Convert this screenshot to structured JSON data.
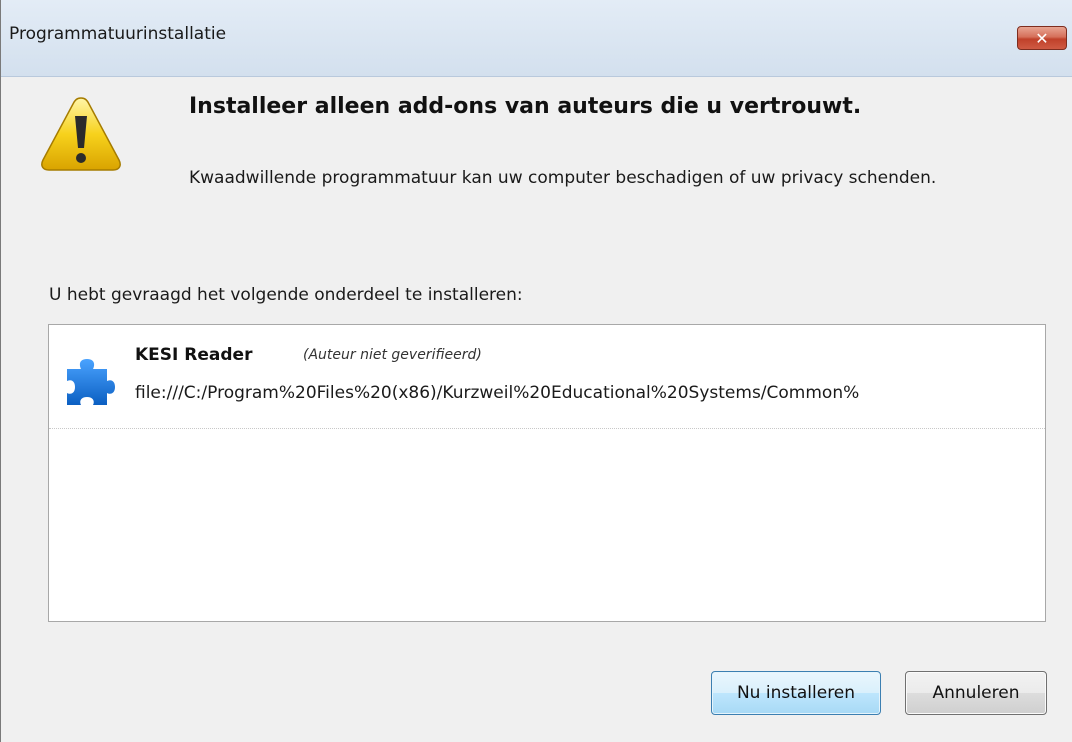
{
  "window": {
    "title": "Programmatuurinstallatie",
    "close_glyph": "✕"
  },
  "warning": {
    "icon": "warning-icon",
    "heading": "Installeer alleen add-ons van auteurs die u vertrouwt.",
    "description": "Kwaadwillende programmatuur kan uw computer beschadigen of uw privacy schenden."
  },
  "install_list": {
    "intro": "U hebt gevraagd het volgende onderdeel te installeren:",
    "items": [
      {
        "icon": "puzzle-piece-icon",
        "name": "KESI Reader",
        "note": "(Auteur niet geverifieerd)",
        "url": "file:///C:/Program%20Files%20(x86)/Kurzweil%20Educational%20Systems/Common%"
      }
    ]
  },
  "buttons": {
    "install_label": "Nu installeren",
    "cancel_label": "Annuleren"
  },
  "colors": {
    "titlebar": "#dae5f1",
    "close_button": "#c9503a",
    "primary_button_border": "#3c7fb1",
    "puzzle_icon": "#1e7fe0",
    "warning_icon": "#f5c800"
  }
}
